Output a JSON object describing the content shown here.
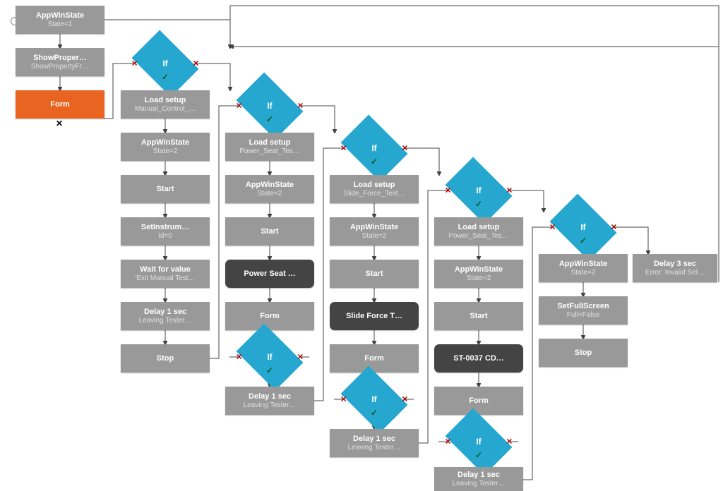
{
  "col0": {
    "appwin": {
      "title": "AppWinState",
      "sub": "State=1"
    },
    "show": {
      "title": "ShowProper…",
      "sub": "ShowPropertyFr…"
    },
    "form": {
      "title": "Form"
    }
  },
  "if_labels": {
    "if": "If"
  },
  "col1": {
    "load": {
      "title": "Load setup",
      "sub": "Manual_Control_…"
    },
    "appwin": {
      "title": "AppWinState",
      "sub": "State=2"
    },
    "start": {
      "title": "Start"
    },
    "instr": {
      "title": "SetInstrum…",
      "sub": "Id=0"
    },
    "wait": {
      "title": "Wait for value",
      "sub": "'Exit Manual Test…"
    },
    "delay": {
      "title": "Delay 1 sec",
      "sub": "Leaving Tester…"
    },
    "stop": {
      "title": "Stop"
    }
  },
  "col2": {
    "load": {
      "title": "Load setup",
      "sub": "Power_Seat_Tes…"
    },
    "appwin": {
      "title": "AppWinState",
      "sub": "State=2"
    },
    "start": {
      "title": "Start"
    },
    "power": {
      "title": "Power Seat …"
    },
    "form": {
      "title": "Form"
    },
    "delay": {
      "title": "Delay 1 sec",
      "sub": "Leaving Tester…"
    }
  },
  "col3": {
    "load": {
      "title": "Load setup",
      "sub": "Slide_Force_Test…"
    },
    "appwin": {
      "title": "AppWinState",
      "sub": "State=2"
    },
    "start": {
      "title": "Start"
    },
    "slide": {
      "title": "Slide Force T…"
    },
    "form": {
      "title": "Form"
    },
    "delay": {
      "title": "Delay 1 sec",
      "sub": "Leaving Tester…"
    }
  },
  "col4": {
    "load": {
      "title": "Load setup",
      "sub": "Power_Seat_Tes…"
    },
    "appwin": {
      "title": "AppWinState",
      "sub": "State=2"
    },
    "start": {
      "title": "Start"
    },
    "st": {
      "title": "ST-0037 CD…"
    },
    "form": {
      "title": "Form"
    },
    "delay": {
      "title": "Delay 1 sec",
      "sub": "Leaving Tester…"
    }
  },
  "col5": {
    "appwin": {
      "title": "AppWinState",
      "sub": "State=2"
    },
    "full": {
      "title": "SetFullScreen",
      "sub": "Full=False"
    },
    "stop": {
      "title": "Stop"
    }
  },
  "col6": {
    "delay": {
      "title": "Delay 3 sec",
      "sub": "Error: Invalid Sel…"
    }
  }
}
